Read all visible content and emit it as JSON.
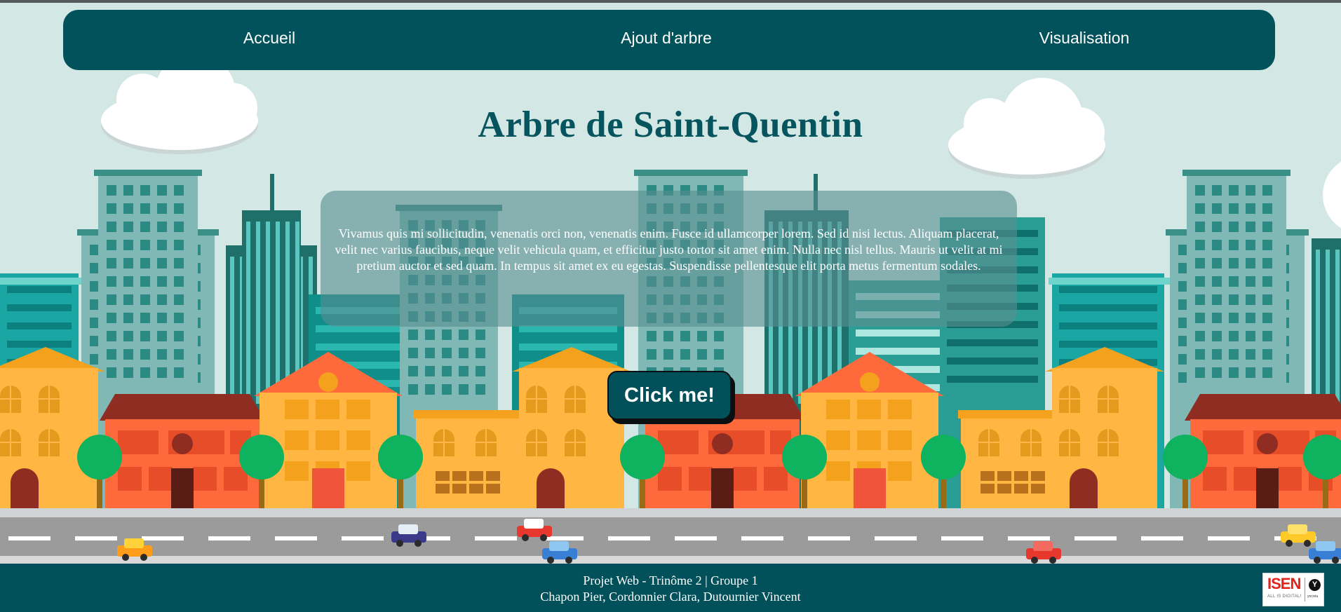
{
  "nav": {
    "items": [
      {
        "label": "Accueil"
      },
      {
        "label": "Ajout d'arbre"
      },
      {
        "label": "Visualisation"
      }
    ]
  },
  "hero": {
    "title": "Arbre de Saint-Quentin",
    "description": "Vivamus quis mi sollicitudin, venenatis orci non, venenatis enim. Fusce id ullamcorper lorem. Sed id nisi lectus. Aliquam placerat, velit nec varius faucibus, neque velit vehicula quam, et efficitur justo tortor sit amet enim. Nulla nec nisl tellus. Mauris ut velit at mi pretium auctor et sed quam. In tempus sit amet ex eu egestas. Suspendisse pellentesque elit porta metus fermentum sodales.",
    "button_label": "Click me!"
  },
  "footer": {
    "line1": "Projet Web - Trinôme 2 | Groupe 1",
    "line2": "Chapon Pier, Cordonnier Clara, Dutournier Vincent",
    "logo_text": "ISEN",
    "logo_subtext": "ALL IS DIGITAL!",
    "logo_partner": "yncréa"
  },
  "colors": {
    "background": "#d3e7e4",
    "navbar": "#02525c",
    "title": "#06545e",
    "footer": "#02505a",
    "button": "#02505a"
  },
  "icons": {
    "clouds": "cloud-icon",
    "buildings": "skyscraper-icon",
    "houses": "house-icon",
    "trees": "tree-icon",
    "vehicles": "car-icon",
    "logo": "isen-logo"
  }
}
